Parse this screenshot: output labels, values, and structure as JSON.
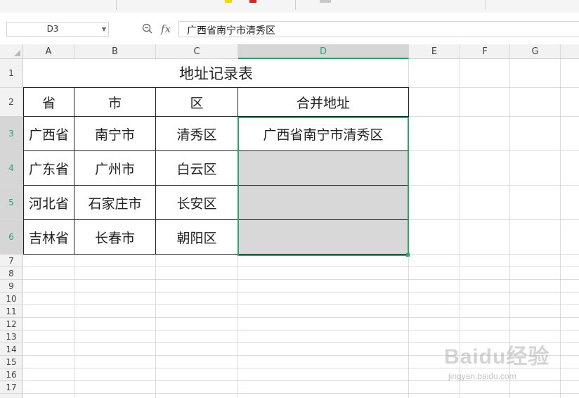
{
  "name_box": {
    "value": "D3"
  },
  "formula_bar": {
    "fx_label": "fx",
    "content": "广西省南宁市清秀区"
  },
  "columns": [
    "A",
    "B",
    "C",
    "D",
    "E",
    "F",
    "G"
  ],
  "rows": [
    "1",
    "2",
    "3",
    "4",
    "5",
    "6",
    "7",
    "8",
    "9",
    "10",
    "11",
    "12",
    "13",
    "14",
    "15",
    "16",
    "17"
  ],
  "active_cell": {
    "column": "D",
    "row": "3"
  },
  "table": {
    "title": "地址记录表",
    "headers": [
      "省",
      "市",
      "区",
      "合并地址"
    ],
    "rows": [
      [
        "广西省",
        "南宁市",
        "清秀区",
        "广西省南宁市清秀区"
      ],
      [
        "广东省",
        "广州市",
        "白云区",
        ""
      ],
      [
        "河北省",
        "石家庄市",
        "长安区",
        ""
      ],
      [
        "吉林省",
        "长春市",
        "朝阳区",
        ""
      ]
    ]
  },
  "colors": {
    "accent": "#22a96b",
    "empty_fill": "#d8d8d8",
    "header_bg": "#f2f2f2"
  },
  "watermark": {
    "text": "Baidu经验",
    "sub": "jingyan.baidu.com"
  },
  "icons": [
    "zoom-icon",
    "fx-icon",
    "dropdown-arrow-icon",
    "select-all-icon"
  ]
}
